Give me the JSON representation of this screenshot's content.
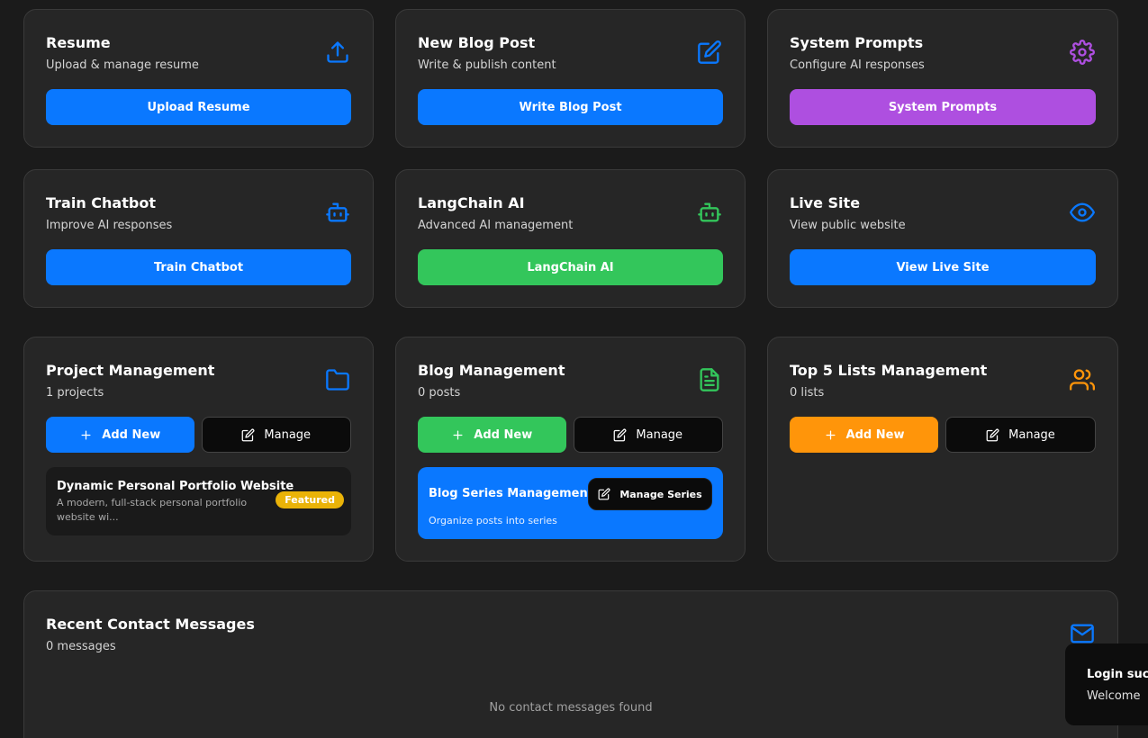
{
  "cards": {
    "resume": {
      "title": "Resume",
      "subtitle": "Upload & manage resume",
      "button": "Upload Resume",
      "icon": "upload-icon",
      "color": "#0a78ff"
    },
    "blog_post": {
      "title": "New Blog Post",
      "subtitle": "Write & publish content",
      "button": "Write Blog Post",
      "icon": "edit-icon",
      "color": "#0a78ff"
    },
    "system_prompts": {
      "title": "System Prompts",
      "subtitle": "Configure AI responses",
      "button": "System Prompts",
      "icon": "gear-icon",
      "color": "#ae4fe0"
    },
    "train_chatbot": {
      "title": "Train Chatbot",
      "subtitle": "Improve AI responses",
      "button": "Train Chatbot",
      "icon": "bot-icon",
      "color": "#0a78ff"
    },
    "langchain": {
      "title": "LangChain AI",
      "subtitle": "Advanced AI management",
      "button": "LangChain AI",
      "icon": "bot-icon",
      "color": "#33c65b"
    },
    "live_site": {
      "title": "Live Site",
      "subtitle": "View public website",
      "button": "View Live Site",
      "icon": "eye-icon",
      "color": "#0a78ff"
    }
  },
  "project_mgmt": {
    "title": "Project Management",
    "subtitle": "1 projects",
    "add_label": "Add New",
    "manage_label": "Manage",
    "icon": "folder-icon",
    "item": {
      "title": "Dynamic Personal Portfolio Website",
      "desc": "A modern, full-stack personal portfolio website wi...",
      "badge": "Featured"
    }
  },
  "blog_mgmt": {
    "title": "Blog Management",
    "subtitle": "0 posts",
    "add_label": "Add New",
    "manage_label": "Manage",
    "icon": "document-icon",
    "series": {
      "title": "Blog Series Management",
      "button": "Manage Series",
      "subtitle": "Organize posts into series"
    }
  },
  "lists_mgmt": {
    "title": "Top 5 Lists Management",
    "subtitle": "0 lists",
    "add_label": "Add New",
    "manage_label": "Manage",
    "icon": "users-icon"
  },
  "messages": {
    "title": "Recent Contact Messages",
    "subtitle": "0 messages",
    "empty": "No contact messages found",
    "icon": "mail-icon"
  },
  "toast": {
    "title": "Login succ",
    "text": "Welcome"
  }
}
